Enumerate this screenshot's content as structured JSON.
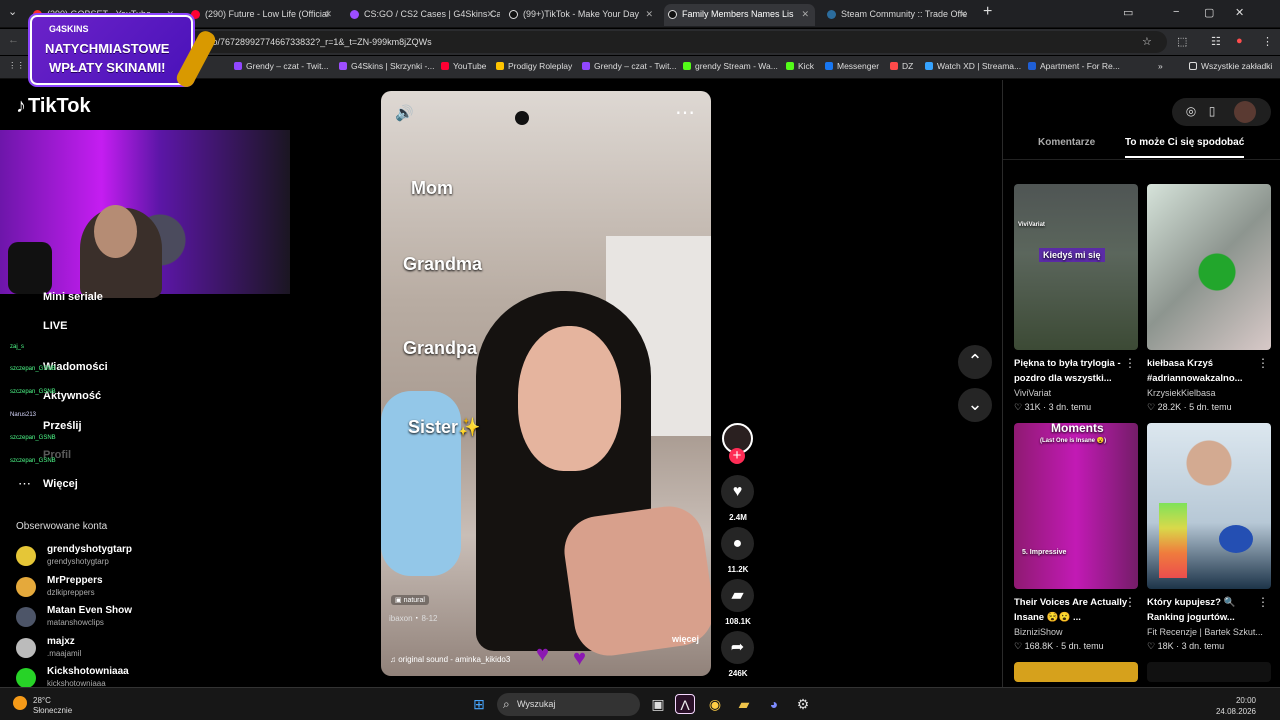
{
  "browser": {
    "tabs": [
      {
        "label": "(290) GOBSET - YouTube",
        "color": "#ff2d2d"
      },
      {
        "label": "(290) Future - Low Life (Official",
        "color": "#ff0033"
      },
      {
        "label": "CS:GO / CS2 Cases | G4Skins Ca",
        "color": "#9d4dff"
      },
      {
        "label": "(99+)TikTok - Make Your Day",
        "color": "#111111"
      },
      {
        "label": "Family Members Names Lis",
        "color": "#111111"
      },
      {
        "label": "Steam Community :: Trade Offe",
        "color": "#2b6c9d"
      }
    ],
    "url": "video/7672899277466733832?_r=1&_t=ZN-999km8jZQWs",
    "bookmarks": [
      "Grendy – czat - Twit...",
      "G4Skins | Skrzynki -...",
      "YouTube",
      "Prodigy Roleplay",
      "Grendy – czat - Twit...",
      "grendy Stream - Wa...",
      "Kick",
      "Messenger",
      "DZ",
      "Watch XD | Streama...",
      "Apartment - For Re...",
      "Wszystkie zakładki"
    ],
    "promo": {
      "brand": "G4SKINS",
      "line1": "NATYCHMIASTOWE",
      "line2": "WPŁATY SKINAMI!"
    }
  },
  "left": {
    "logo": "TikTok",
    "nav": [
      "Mini seriale",
      "LIVE",
      "Wiadomości",
      "Aktywność",
      "Prześlij",
      "Profil",
      "Więcej"
    ],
    "chat": [
      "zaj_s",
      "szczepan_GSNB",
      "szczepan_GSNB",
      "Narus213",
      "szczepan_GSNB",
      "szczepan_GSNB"
    ],
    "following_title": "Obserwowane konta",
    "following": [
      {
        "name": "grendyshotygtarp",
        "handle": "grendyshotygtarp",
        "color": "#e5c637"
      },
      {
        "name": "MrPreppers",
        "handle": "dzlkipreppers",
        "color": "#e5a93b"
      },
      {
        "name": "Matan Even Show",
        "handle": "matanshowclips",
        "color": "#4d5568"
      },
      {
        "name": "majxz",
        "handle": ".maajamil",
        "color": "#bbbbbb"
      },
      {
        "name": "Kickshotowniaaa",
        "handle": "kickshotowniaaa",
        "color": "#27d327"
      }
    ]
  },
  "video": {
    "captions": [
      "Mom",
      "Grandma",
      "Grandpa",
      "Sister✨"
    ],
    "pill": "natural",
    "author": "ibaxon",
    "date": "8-12",
    "more": "więcej",
    "sound": "original sound - aminka_kikido3",
    "stats": {
      "likes": "2.4M",
      "comments": "11.2K",
      "saves": "108.1K",
      "shares": "246K"
    }
  },
  "right": {
    "tabs": [
      "Komentarze",
      "To może Ci się spodobać"
    ],
    "cards": [
      {
        "title": "Piękna to była trylogia - pozdro dla wszystki...",
        "author": "ViviVariat",
        "likes": "31K",
        "ago": "3 dn. temu",
        "overlay": "Kiedyś mi się",
        "top": "ViviVariat"
      },
      {
        "title": "kiełbasa Krzyś #adriannowakzalno...",
        "author": "KrzysiekKielbasa",
        "likes": "28.2K",
        "ago": "5 dn. temu",
        "overlay": "",
        "top": ""
      },
      {
        "title": "Their Voices Are Actually Insane 😵😮 ...",
        "author": "BizniziShow",
        "likes": "168.8K",
        "ago": "5 dn. temu",
        "overlay": "Moments",
        "subtitle": "(Last One is Insane 😮)",
        "top": "5. Impressive"
      },
      {
        "title": "Który kupujesz? 🔍 Ranking jogurtów...",
        "author": "Fit Recenzje | Bartek Szkut...",
        "likes": "18K",
        "ago": "3 dn. temu",
        "overlay": "",
        "top": ""
      }
    ]
  },
  "taskbar": {
    "weather": "28°C",
    "weather_desc": "Słonecznie",
    "search": "Wyszukaj",
    "time": "20:00",
    "date": "24.08.2026"
  }
}
